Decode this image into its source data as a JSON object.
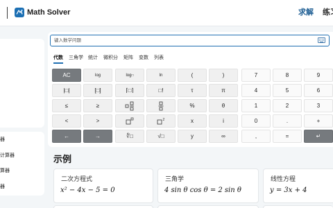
{
  "header": {
    "app_title": "Math Solver",
    "nav": {
      "solve": "求解",
      "practice": "练习"
    },
    "logo_icon": "math-solver-logo-icon",
    "brand_color": "#1f5f94"
  },
  "sidebar": {
    "items": [
      {
        "label": "器"
      },
      {
        "label": "计算器"
      },
      {
        "label": "算器"
      },
      {
        "label": "器"
      }
    ]
  },
  "math_input": {
    "placeholder": "键入数学问题",
    "keyboard_icon": "keyboard-icon"
  },
  "tabs": [
    {
      "label": "代数",
      "active": true
    },
    {
      "label": "三角学"
    },
    {
      "label": "统计"
    },
    {
      "label": "微积分"
    },
    {
      "label": "矩阵"
    },
    {
      "label": "变数"
    },
    {
      "label": "列表"
    }
  ],
  "keypad": {
    "row1": [
      "AC",
      "log",
      "log□",
      "ln",
      "(",
      ")",
      "7",
      "8",
      "9"
    ],
    "row2": [
      "|□|",
      "[□]",
      "⌈□⌉",
      "□!",
      "τ",
      "π",
      "4",
      "5",
      "6"
    ],
    "row3": [
      "≤",
      "≥",
      "□/□",
      "□/□",
      "%",
      "θ",
      "1",
      "2",
      "3"
    ],
    "row4": [
      "<",
      ">",
      "□□",
      "□2",
      "x",
      "i",
      "0",
      ".",
      "+"
    ],
    "row5": [
      "←",
      "→",
      "∜□",
      "√□",
      "y",
      "∞",
      ",",
      "=",
      "↵"
    ]
  },
  "examples": {
    "title": "示例",
    "cards": [
      {
        "title": "二次方程式",
        "equation": "x² − 4x − 5 = 0"
      },
      {
        "title": "三角学",
        "equation": "4 sin θ cos θ = 2 sin θ"
      },
      {
        "title": "线性方程",
        "equation": "y = 3x + 4"
      }
    ]
  }
}
